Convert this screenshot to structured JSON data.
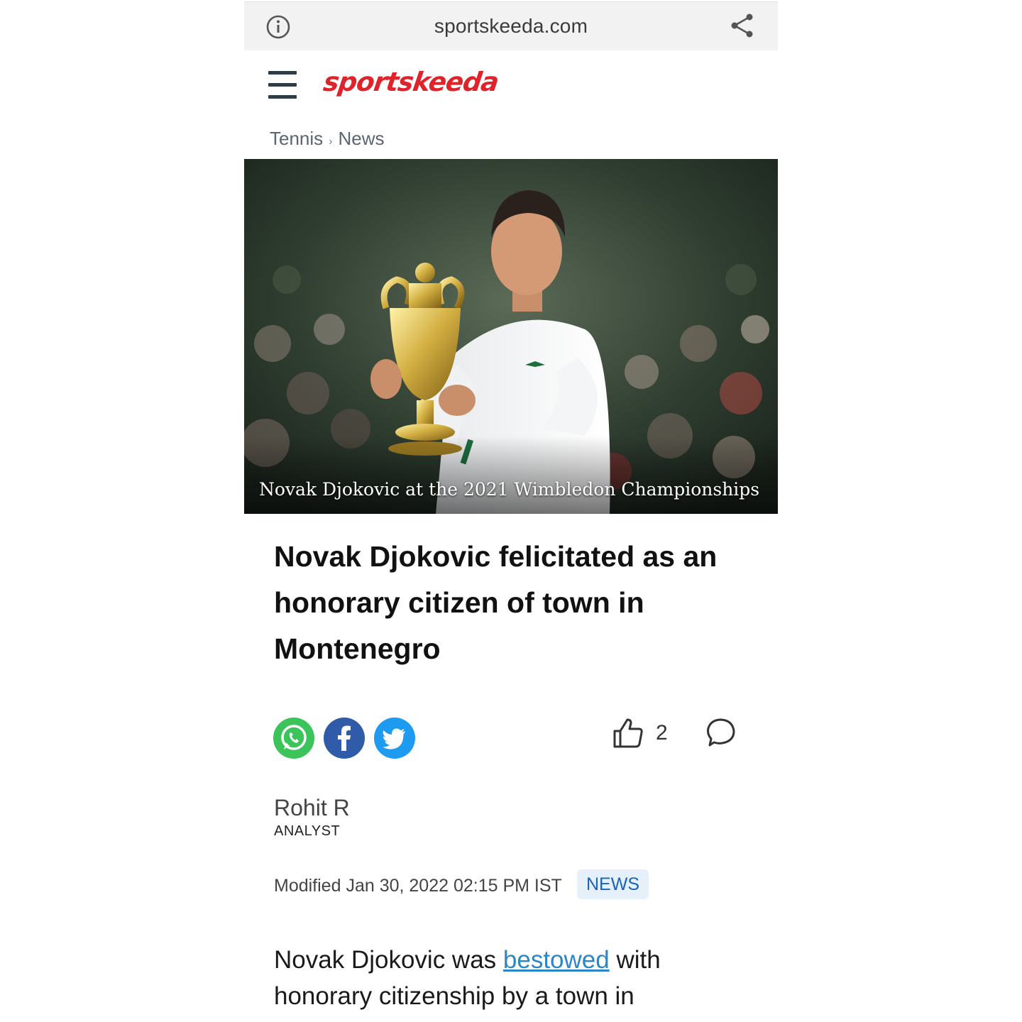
{
  "browser": {
    "domain": "sportskeeda.com",
    "info_icon": "info-icon",
    "share_icon": "share-icon"
  },
  "header": {
    "menu_icon": "hamburger-menu-icon",
    "logo_text": "sportskeeda",
    "logo_color": "#e0232b"
  },
  "breadcrumb": [
    "Tennis",
    "News"
  ],
  "hero": {
    "caption": "Novak Djokovic at the 2021 Wimbledon Championships"
  },
  "article": {
    "title": "Novak Djokovic felicitated as an honorary citizen of town in Montenegro",
    "author": "Rohit R",
    "author_role": "ANALYST",
    "modified": "Modified Jan 30, 2022 02:15 PM IST",
    "category_badge": "NEWS",
    "body_prefix": "Novak Djokovic was ",
    "body_link": "bestowed",
    "body_suffix": " with honorary citizenship by a town in"
  },
  "engagement": {
    "like_count": "2",
    "share_buttons": [
      "whatsapp",
      "facebook",
      "twitter"
    ]
  }
}
